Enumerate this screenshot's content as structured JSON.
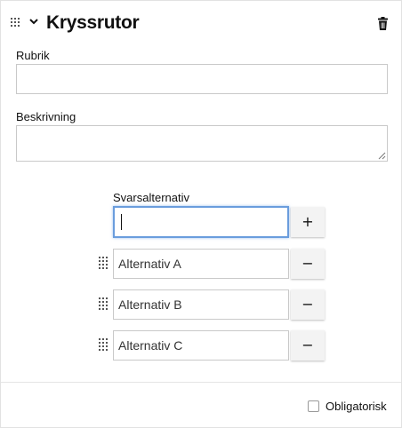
{
  "header": {
    "title": "Kryssrutor",
    "drag_icon": "drag-handle-icon",
    "collapse_icon": "chevron-down-icon",
    "delete_icon": "trash-icon"
  },
  "fields": {
    "rubrik_label": "Rubrik",
    "rubrik_value": "",
    "beskrivning_label": "Beskrivning",
    "beskrivning_value": ""
  },
  "options": {
    "label": "Svarsalternativ",
    "new_value": "",
    "add_label": "+",
    "remove_label": "−",
    "items": [
      {
        "label": "Alternativ A"
      },
      {
        "label": "Alternativ B"
      },
      {
        "label": "Alternativ C"
      }
    ]
  },
  "footer": {
    "required_label": "Obligatorisk",
    "required_checked": false
  },
  "colors": {
    "focus": "#6a9ddd",
    "border": "#c9c9c9",
    "button_bg": "#f3f3f3"
  }
}
